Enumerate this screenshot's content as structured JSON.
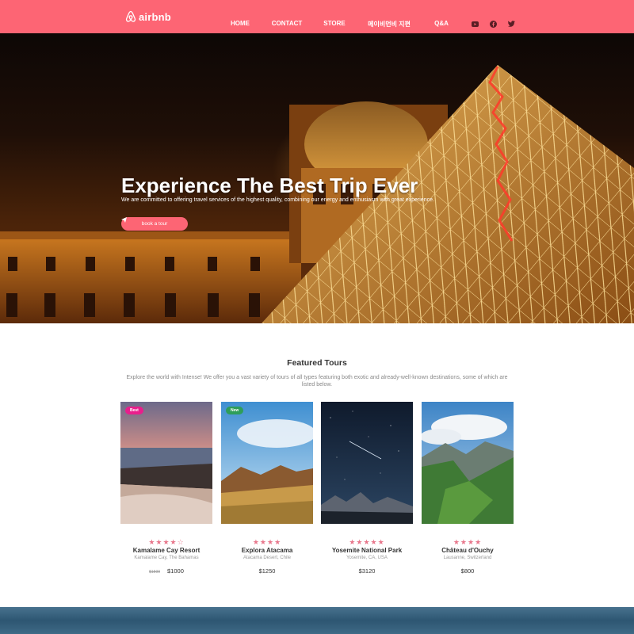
{
  "nav": {
    "brand": "airbnb",
    "links": [
      "HOME",
      "CONTACT",
      "STORE",
      "메이비먼비 지편",
      "Q&A"
    ],
    "social_icons": [
      "youtube-icon",
      "facebook-icon",
      "twitter-icon"
    ]
  },
  "hero": {
    "title": "Experience The Best Trip Ever",
    "subtitle": "We are committed to offering travel services of the highest quality, combining our energy and enthusiasm with great experience.",
    "button_label": "book a tour"
  },
  "featured": {
    "title": "Featured Tours",
    "description": "Explore the world with Intense! We offer you a vast variety of tours of all types featuring both exotic and already-well-known destinations, some of which are listed below."
  },
  "tours": [
    {
      "badge": "Best",
      "badge_color": "#e91e8c",
      "rating": 4.5,
      "name": "Kamalame Cay Resort",
      "location": "Kamalame Cay, The Bahamas",
      "old_price": "$1500",
      "price": "$1000"
    },
    {
      "badge": "New",
      "badge_color": "#2e9e5a",
      "rating": 4,
      "name": "Explora Atacama",
      "location": "Atacama Desert, Chile",
      "old_price": "",
      "price": "$1250"
    },
    {
      "badge": "",
      "badge_color": "",
      "rating": 5,
      "name": "Yosemite National Park",
      "location": "Yosemite, CA, USA",
      "old_price": "",
      "price": "$3120"
    },
    {
      "badge": "",
      "badge_color": "",
      "rating": 4,
      "name": "Château d'Ouchy",
      "location": "Lausanne, Switzerland",
      "old_price": "",
      "price": "$800"
    }
  ],
  "colors": {
    "accent": "#fd6574",
    "stars": "#e8768b"
  }
}
